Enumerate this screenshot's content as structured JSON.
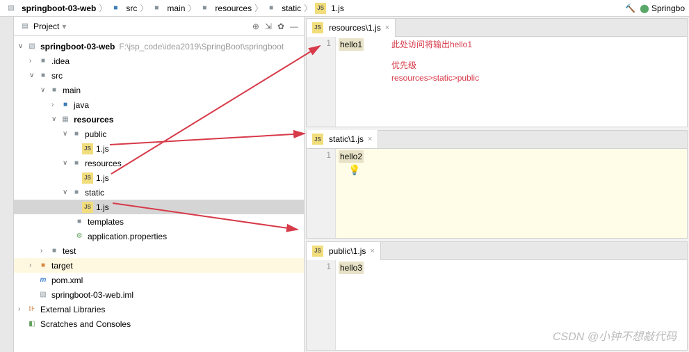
{
  "breadcrumb": {
    "items": [
      "springboot-03-web",
      "src",
      "main",
      "resources",
      "static",
      "1.js"
    ],
    "right_label": "Springbo"
  },
  "project_panel": {
    "title": "Project"
  },
  "tree": {
    "root": "springboot-03-web",
    "root_path": "F:\\jsp_code\\idea2019\\SpringBoot\\springboot",
    "idea": ".idea",
    "src": "src",
    "main": "main",
    "java": "java",
    "resources": "resources",
    "public": "public",
    "public_file": "1.js",
    "resources_sub": "resources",
    "resources_file": "1.js",
    "static": "static",
    "static_file": "1.js",
    "templates": "templates",
    "app_props": "application.properties",
    "test": "test",
    "target": "target",
    "pom": "pom.xml",
    "iml": "springboot-03-web.iml",
    "ext_libs": "External Libraries",
    "scratches": "Scratches and Consoles"
  },
  "editors": {
    "pane1": {
      "tab": "resources\\1.js",
      "line": "1",
      "content": "hello1",
      "note1": "此处访问将输出hello1",
      "note2": "优先级",
      "note3": "resources>static>public"
    },
    "pane2": {
      "tab": "static\\1.js",
      "line": "1",
      "content": "hello2"
    },
    "pane3": {
      "tab": "public\\1.js",
      "line": "1",
      "content": "hello3"
    }
  },
  "watermark": "CSDN @小钟不想敲代码"
}
